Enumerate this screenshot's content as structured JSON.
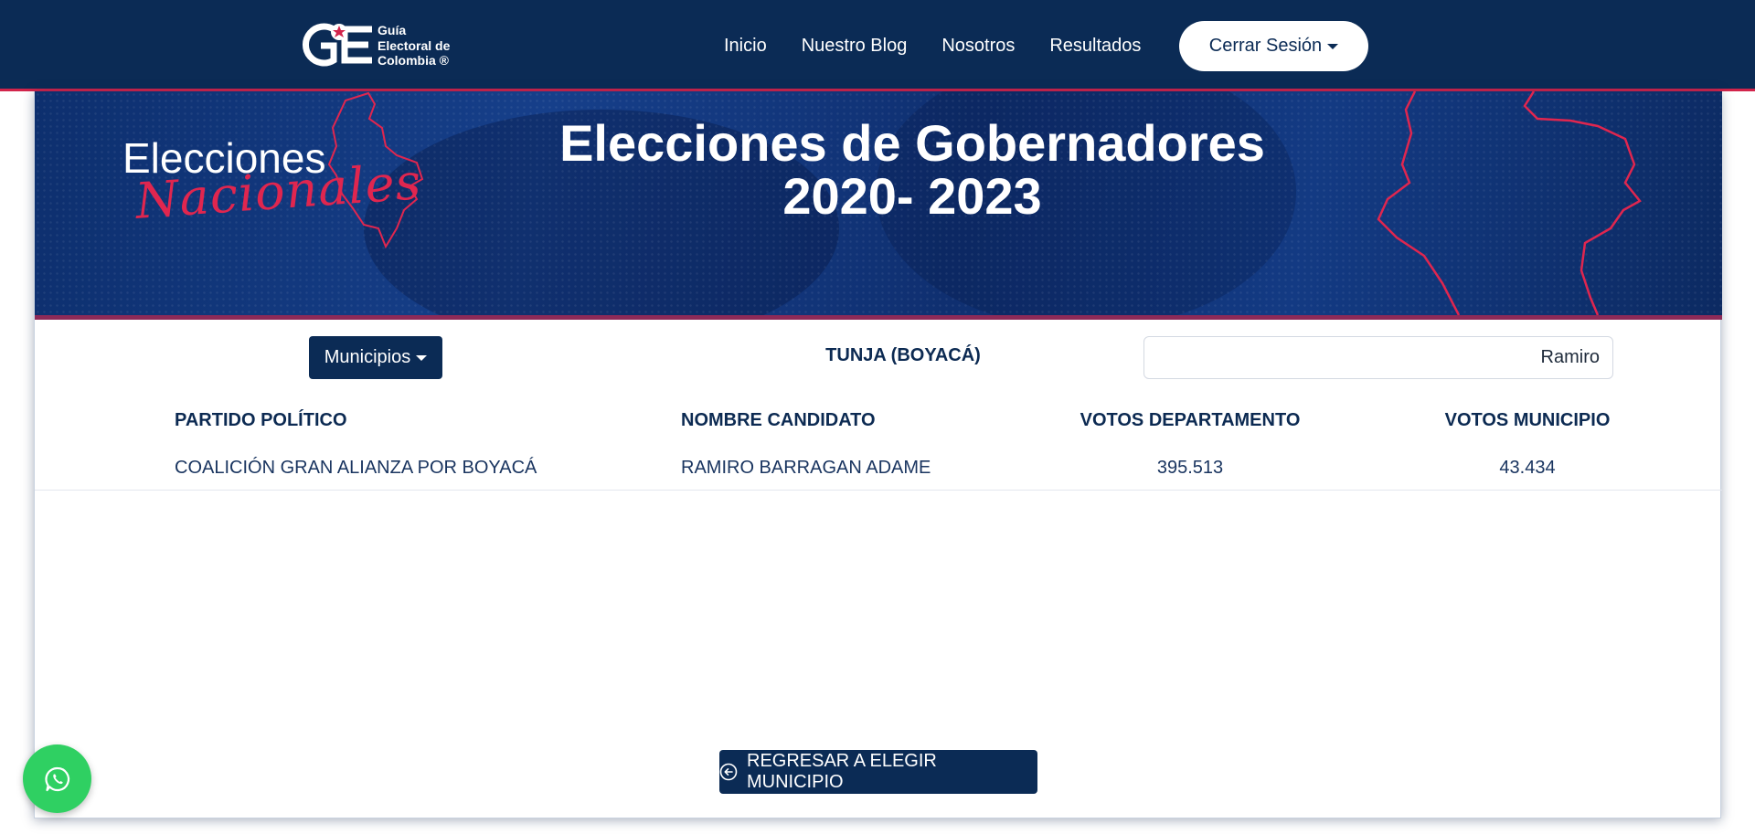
{
  "navbar": {
    "logo_monogram": "GE",
    "logo_lines": [
      "Guía",
      "Electoral de",
      "Colombia ®"
    ],
    "links": [
      "Inicio",
      "Nuestro Blog",
      "Nosotros",
      "Resultados"
    ],
    "session_button": "Cerrar Sesión"
  },
  "banner": {
    "brand_top": "Elecciones",
    "brand_bottom": "Nacionales",
    "title_line1": "Elecciones de Gobernadores",
    "title_line2": "2020- 2023"
  },
  "controls": {
    "dropdown_label": "Municipios",
    "location": "TUNJA (BOYACÁ)",
    "search_value": "Ramiro"
  },
  "table": {
    "headers": [
      "PARTIDO POLÍTICO",
      "NOMBRE CANDIDATO",
      "VOTOS DEPARTAMENTO",
      "VOTOS MUNICIPIO"
    ],
    "rows": [
      [
        "COALICIÓN GRAN ALIANZA POR BOYACÁ",
        "RAMIRO BARRAGAN ADAME",
        "395.513",
        "43.434"
      ]
    ]
  },
  "back_button": "REGRESAR A ELEGIR MUNICIPIO",
  "icons": {
    "caret": "caret-down-icon",
    "back": "arrow-left-circle-icon",
    "whatsapp": "whatsapp-icon"
  },
  "colors": {
    "navy": "#0b2b55",
    "accent_red": "#d2244b",
    "whatsapp_green": "#2fd062"
  }
}
